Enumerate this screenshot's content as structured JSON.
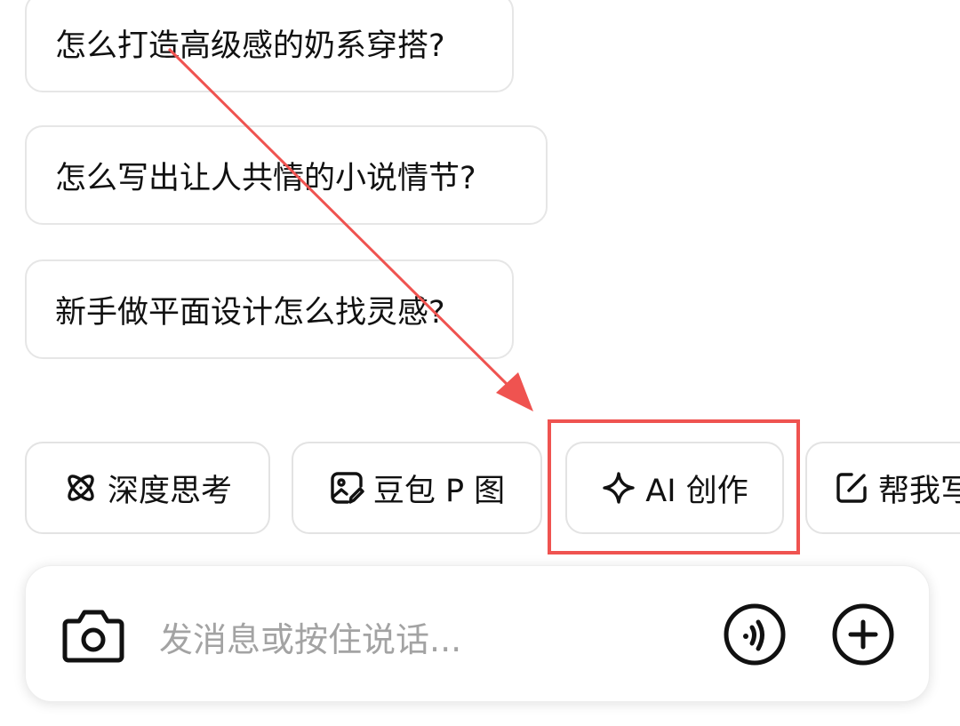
{
  "suggestions": [
    "怎么打造高级感的奶系穿搭?",
    "怎么写出让人共情的小说情节?",
    "新手做平面设计怎么找灵感?"
  ],
  "chips": {
    "deep_think": "深度思考",
    "doubao_p": "豆包 P 图",
    "ai_create": "AI 创作",
    "help_write": "帮我写"
  },
  "input": {
    "placeholder": "发消息或按住说话..."
  },
  "icons": {
    "deep_think": "atom-icon",
    "doubao_p": "image-edit-icon",
    "ai_create": "sparkle-icon",
    "help_write": "edit-square-icon",
    "camera": "camera-icon",
    "voice": "voice-wave-icon",
    "plus": "plus-circle-icon"
  },
  "annotation": {
    "color": "#ef5350"
  }
}
